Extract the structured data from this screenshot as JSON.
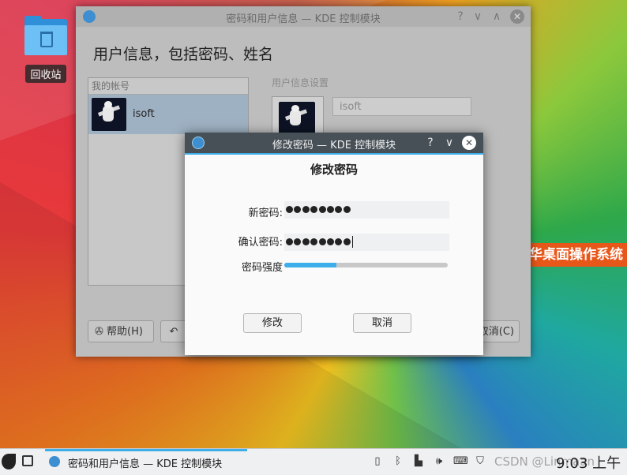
{
  "desktop": {
    "trash_label": "回收站"
  },
  "main_window": {
    "title": "密码和用户信息 — KDE 控制模块",
    "heading": "用户信息，包括密码、姓名",
    "accounts_header": "我的帐号",
    "account_name": "isoft",
    "settings_label": "用户信息设置",
    "username_value": "isoft",
    "help_button": "帮助(H)",
    "reset_button": "↶",
    "cancel_button": "取消(C)",
    "window_buttons": {
      "help": "?",
      "min": "∨",
      "max": "∧",
      "close": "✕"
    }
  },
  "dialog": {
    "title": "修改密码 — KDE 控制模块",
    "heading": "修改密码",
    "new_password_label": "新密码:",
    "confirm_password_label": "确认密码:",
    "new_password_length": 8,
    "confirm_password_length": 8,
    "strength_label": "密码强度",
    "strength_fraction": 0.32,
    "ok_button": "修改",
    "cancel_button": "取消",
    "window_buttons": {
      "help": "?",
      "min": "∨",
      "close": "✕"
    }
  },
  "overlay_banner": "华桌面操作系统",
  "taskbar": {
    "task_label": "密码和用户信息 — KDE 控制模块",
    "clock": "9:03 上午",
    "watermark": "CSDN @Linmaan"
  },
  "colors": {
    "accent": "#3daee9",
    "dialog_titlebar": "#475057",
    "banner": "#e8571a"
  }
}
